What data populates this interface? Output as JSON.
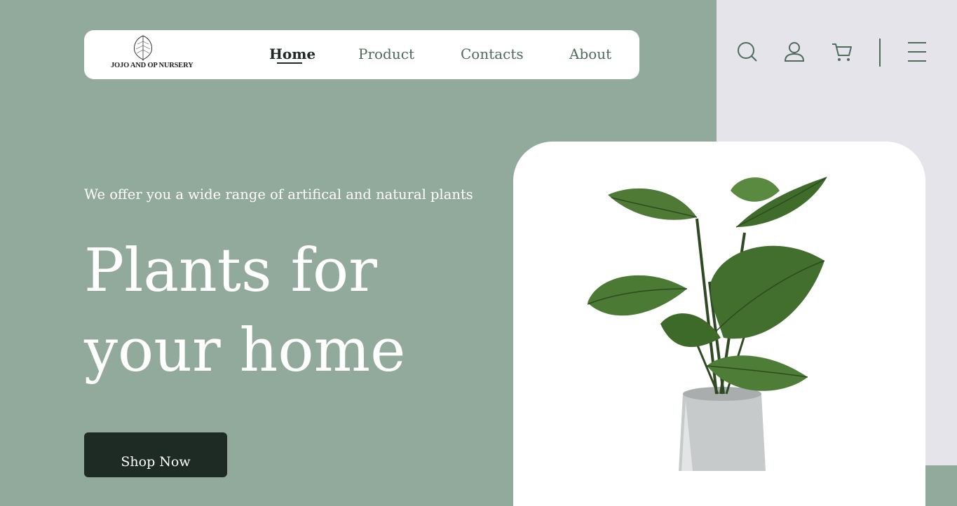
{
  "brand": {
    "logo_text": "JOJO AND OP NURSERY",
    "logo_icon": "leaf-icon"
  },
  "nav": {
    "items": [
      {
        "label": "Home",
        "active": true
      },
      {
        "label": "Product",
        "active": false
      },
      {
        "label": "Contacts",
        "active": false
      },
      {
        "label": "About",
        "active": false
      }
    ]
  },
  "header_icons": [
    "search-icon",
    "user-icon",
    "cart-icon",
    "menu-icon"
  ],
  "hero": {
    "subtitle": "We offer you a wide range of artifical and natural plants",
    "title_line1": "Plants for",
    "title_line2": "your home",
    "cta_label": "Shop Now"
  },
  "product_image": "potted-monstera-plant",
  "colors": {
    "background": "#92aa9b",
    "side_panel": "#e5e4ea",
    "card": "#ffffff",
    "dark_accent": "#1e2a24",
    "muted_green": "#4f6b5c"
  }
}
